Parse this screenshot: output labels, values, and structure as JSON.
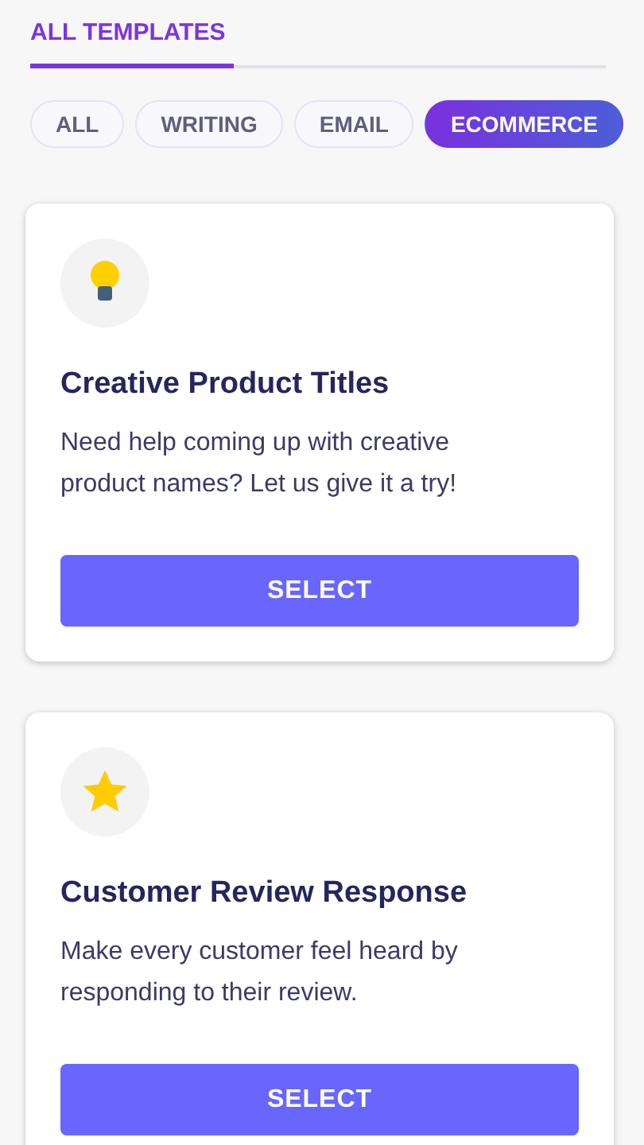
{
  "tabs": [
    {
      "label": "ALL TEMPLATES",
      "selected": true
    }
  ],
  "filters": [
    {
      "label": "ALL",
      "selected": false
    },
    {
      "label": "WRITING",
      "selected": false
    },
    {
      "label": "EMAIL",
      "selected": false
    },
    {
      "label": "ECOMMERCE",
      "selected": true
    }
  ],
  "templates": [
    {
      "kind": "bulb",
      "title": "Creative Product Titles",
      "description": "Need help coming up with creative product names? Let us give it a try!",
      "button": "SELECT"
    },
    {
      "kind": "star",
      "title": "Customer Review Response",
      "description": "Make every customer feel heard by responding to their review.",
      "button": "SELECT"
    }
  ]
}
